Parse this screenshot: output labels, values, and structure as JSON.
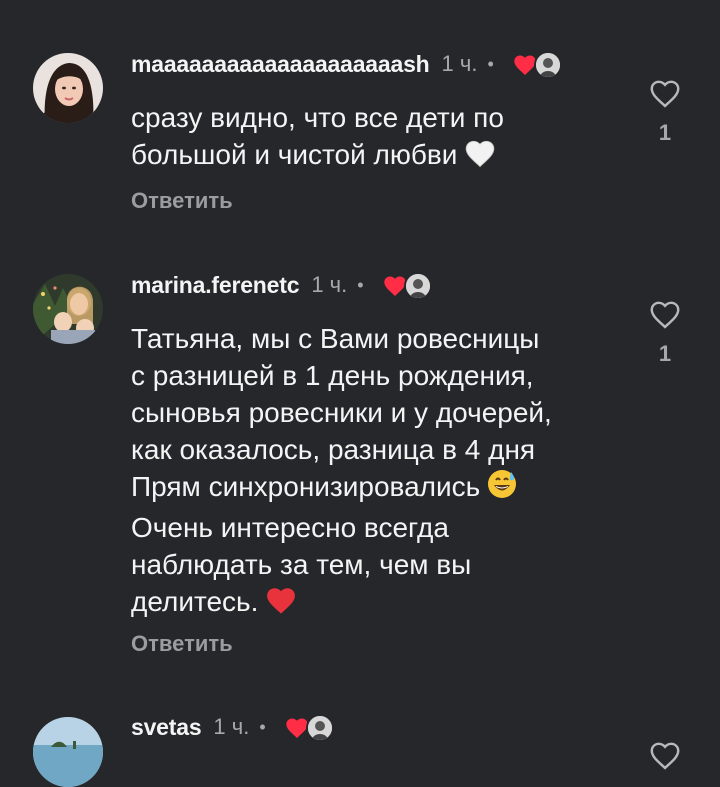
{
  "comments": [
    {
      "username": "maaaaaaaaaaaaaaaaaaaash",
      "time": "1 ч.",
      "dot": "•",
      "text_lines": [
        "сразу видно, что все дети по",
        "большой и чистой любви"
      ],
      "trailing_emoji": "white-heart",
      "reply_label": "Ответить",
      "like_count": "1"
    },
    {
      "username": "marina.ferenetc",
      "time": "1 ч.",
      "dot": "•",
      "text_lines": [
        "Татьяна, мы с Вами ровесницы",
        "с разницей в 1 день рождения,",
        "сыновья ровесники и у дочерей,",
        "как оказалось, разница в 4 дня",
        "Прям синхронизировались",
        "Очень интересно всегда",
        "наблюдать за тем, чем вы",
        "делитесь."
      ],
      "reply_label": "Ответить",
      "like_count": "1"
    },
    {
      "username": "svetas",
      "time": "1 ч.",
      "dot": "•"
    }
  ],
  "icons": {
    "like": "heart-outline-icon",
    "author_like": "red-heart-icon",
    "emoji_1": "white-heart-emoji",
    "emoji_2": "grinning-sweat-emoji",
    "emoji_3": "red-heart-emoji"
  },
  "colors": {
    "background": "#25272b",
    "text": "#f4f4f4",
    "muted": "#a6a8ad",
    "heart_red": "#ff2d46"
  }
}
